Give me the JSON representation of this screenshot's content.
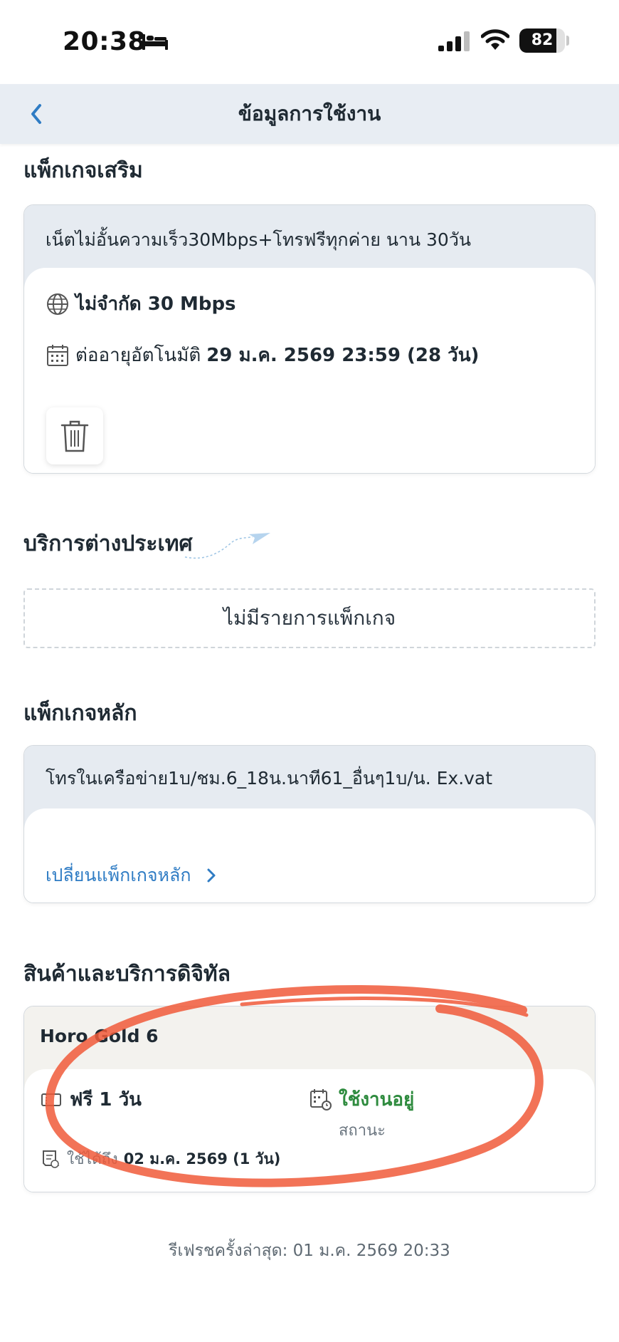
{
  "status_bar": {
    "time": "20:38",
    "battery": "82",
    "battery_level": 0.82
  },
  "nav": {
    "title": "ข้อมูลการใช้งาน"
  },
  "addon": {
    "section_title": "แพ็กเกจเสริม",
    "package_name": "เน็ตไม่อั้นความเร็ว30Mbps+โทรฟรีทุกค่าย นาน 30วัน",
    "speed": "ไม่จำกัด 30 Mbps",
    "renew_label": "ต่ออายุอัตโนมัติ",
    "renew_date": "29 ม.ค. 2569 23:59 (28 วัน)"
  },
  "roaming": {
    "section_title": "บริการต่างประเทศ",
    "empty_text": "ไม่มีรายการแพ็กเกจ"
  },
  "main_package": {
    "section_title": "แพ็กเกจหลัก",
    "package_name": "โทรในเครือข่าย1บ/ชม.6_18น.นาที61_อื่นๆ1บ/น. Ex.vat",
    "change_label": "เปลี่ยนแพ็กเกจหลัก"
  },
  "digital": {
    "section_title": "สินค้าและบริการดิจิทัล",
    "product_name": "Horo Gold 6",
    "price": "ฟรี 1 วัน",
    "status_value": "ใช้งานอยู่",
    "status_label": "สถานะ",
    "valid_label": "ใช้ได้ถึง",
    "valid_date": "02 ม.ค. 2569 (1 วัน)"
  },
  "footer": {
    "refresh_text": "รีเฟรชครั้งล่าสุด: 01 ม.ค. 2569 20:33"
  },
  "colors": {
    "accent": "#2f7cc4",
    "header_bg": "#e8edf3",
    "active_green": "#2e8b3e",
    "annotation_red": "#f05a3a"
  },
  "icons": [
    "bed-icon",
    "signal-icon",
    "wifi-icon",
    "back-chevron-icon",
    "globe-icon",
    "calendar-icon",
    "trash-icon",
    "paper-plane-icon",
    "chevron-right-icon",
    "ticket-icon",
    "calendar-clock-icon",
    "receipt-icon"
  ]
}
